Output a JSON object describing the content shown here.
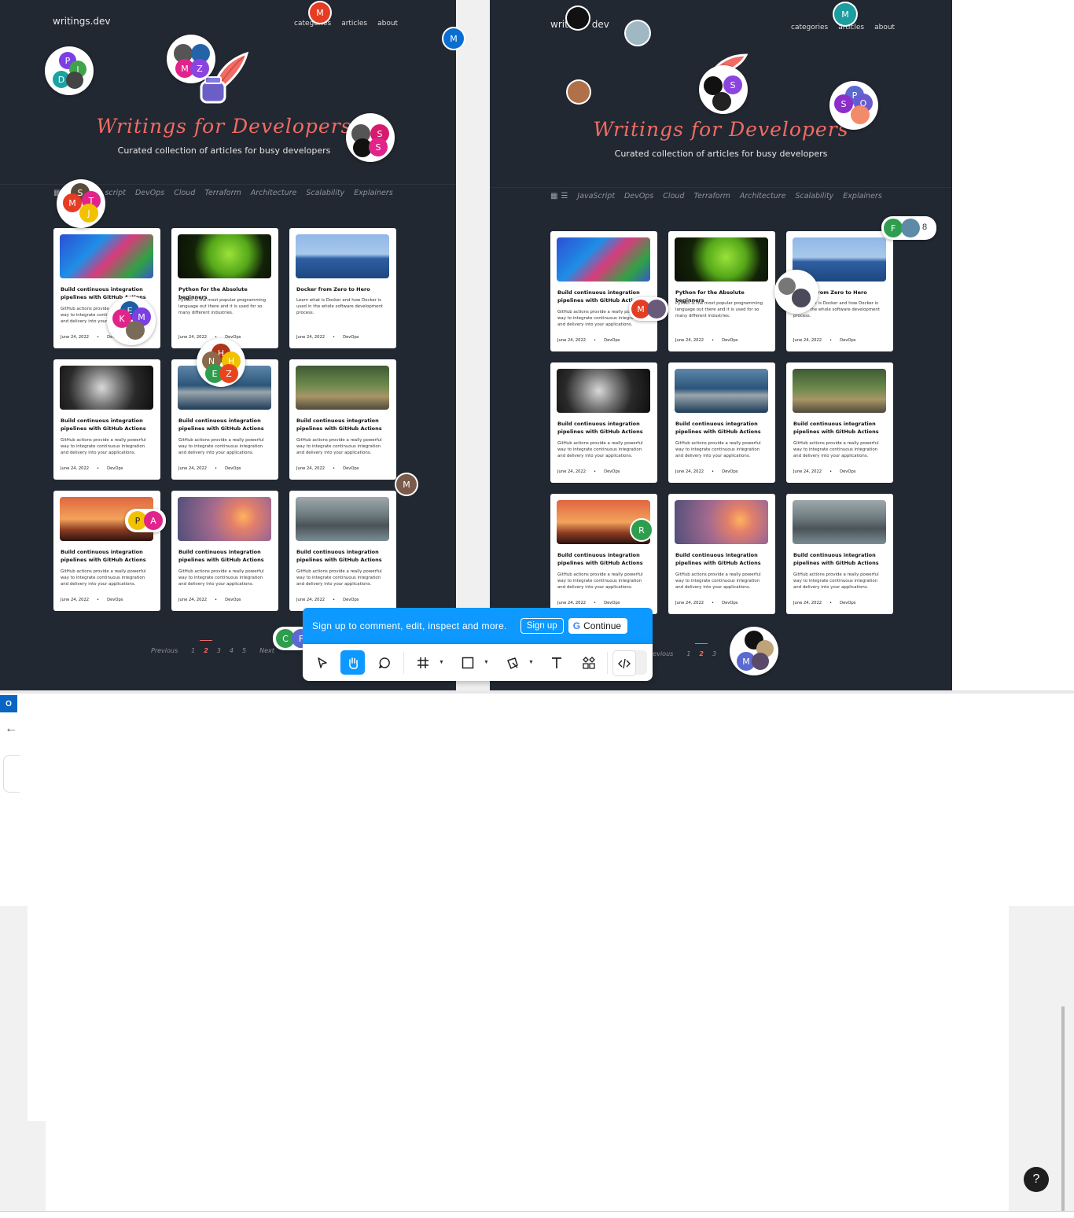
{
  "brand_colors": {
    "accent": "#f26b64",
    "frame_bg": "#222831",
    "figma_blue": "#0d99ff"
  },
  "site": {
    "logo": "writings.dev",
    "logo_right_fragment_a": "writ",
    "logo_right_fragment_b": "dev",
    "nav": [
      "categories",
      "articles",
      "about"
    ],
    "hero_title": "Writings for Developers",
    "hero_subtitle": "Curated collection of articles for busy developers",
    "categories_left": [
      "script",
      "DevOps",
      "Cloud",
      "Terraform",
      "Architecture",
      "Scalability",
      "Explainers"
    ],
    "categories_right": [
      "JavaScript",
      "DevOps",
      "Cloud",
      "Terraform",
      "Architecture",
      "Scalability",
      "Explainers"
    ]
  },
  "cards": [
    {
      "title": "Build continuous integration pipelines with GitHub Actions",
      "desc": "GitHub actions provide a really powerful way to integrate continuous integration and delivery into your applications.",
      "date": "June 24, 2022",
      "tag": "DevOps",
      "thumb": "colorful-robot-image"
    },
    {
      "title": "Python for the Absolute beginners",
      "desc": "Python is the most popular programming language out there and it is used for so many different industries.",
      "date": "June 24, 2022",
      "tag": "DevOps",
      "thumb": "green-python-image"
    },
    {
      "title": "Docker from Zero to Hero",
      "desc": "Learn what is Docker and how Docker is used in the whole software development process.",
      "date": "June 24, 2022",
      "tag": "DevOps",
      "thumb": "whale-image"
    },
    {
      "title": "Build continuous integration pipelines with GitHub Actions",
      "desc": "GitHub actions provide a really powerful way to integrate continuous integration and delivery into your applications.",
      "date": "June 24, 2022",
      "tag": "DevOps",
      "thumb": "gears-image"
    },
    {
      "title": "Build continuous integration pipelines with GitHub Actions",
      "desc": "GitHub actions provide a really powerful way to integrate continuous integration and delivery into your applications.",
      "date": "June 24, 2022",
      "tag": "DevOps",
      "thumb": "boardwalk-image"
    },
    {
      "title": "Build continuous integration pipelines with GitHub Actions",
      "desc": "GitHub actions provide a really powerful way to integrate continuous integration and delivery into your applications.",
      "date": "June 24, 2022",
      "tag": "DevOps",
      "thumb": "robot-field-image"
    },
    {
      "title": "Build continuous integration pipelines with GitHub Actions",
      "desc": "GitHub actions provide a really powerful way to integrate continuous integration and delivery into your applications.",
      "date": "June 24, 2022",
      "tag": "DevOps",
      "thumb": "sunset-lake-image"
    },
    {
      "title": "Build continuous integration pipelines with GitHub Actions",
      "desc": "GitHub actions provide a really powerful way to integrate continuous integration and delivery into your applications.",
      "date": "June 24, 2022",
      "tag": "DevOps",
      "thumb": "sunset-grass-image"
    },
    {
      "title": "Build continuous integration pipelines with GitHub Actions",
      "desc": "GitHub actions provide a really powerful way to integrate continuous integration and delivery into your applications.",
      "date": "June 24, 2022",
      "tag": "DevOps",
      "thumb": "river-image"
    }
  ],
  "pagination": {
    "previous": "Previous",
    "previous_cut": "revious",
    "pages": [
      "1",
      "2",
      "3",
      "4",
      "5"
    ],
    "current": "2",
    "next": "Next"
  },
  "figma": {
    "banner_text": "Sign up to comment, edit, inspect and more.",
    "signup": "Sign up",
    "continue": "Continue",
    "google_glyph": "G",
    "tools": [
      "move-tool",
      "hand-tool",
      "comment-tool",
      "frame-tool",
      "shape-tool",
      "pen-tool",
      "text-tool",
      "components-tool",
      "dev-mode-toggle"
    ],
    "active_tool": "hand-tool",
    "help": "?",
    "viewer_count": "8"
  },
  "avatars": {
    "m": "M",
    "p": "P",
    "i": "I",
    "d": "D",
    "z": "Z",
    "s": "S",
    "t": "T",
    "j": "J",
    "e": "E",
    "h": "H",
    "n": "N",
    "k": "K",
    "a": "A",
    "r": "R",
    "f": "F",
    "c": "C",
    "o": "O"
  }
}
